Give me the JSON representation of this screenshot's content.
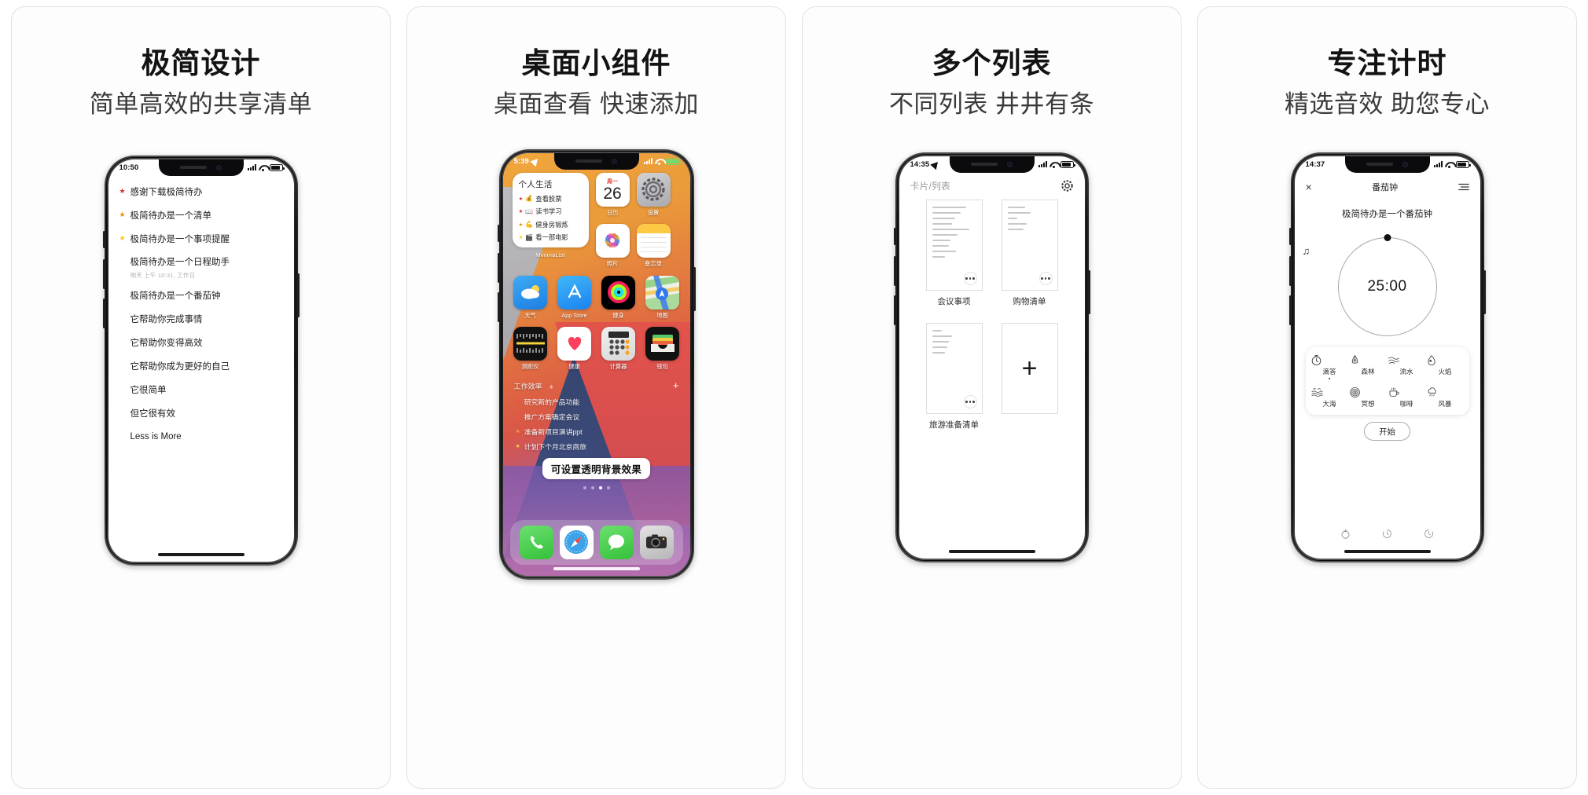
{
  "panels": [
    {
      "title": "极简设计",
      "subtitle": "简单高效的共享清单",
      "phone": {
        "status": {
          "time": "10:50"
        },
        "todos": [
          {
            "text": "感谢下载极简待办",
            "star": "#e03131",
            "meta": ""
          },
          {
            "text": "极简待办是一个清单",
            "star": "#f08c00",
            "meta": ""
          },
          {
            "text": "极简待办是一个事项提醒",
            "star": "#f5cb12",
            "meta": ""
          },
          {
            "text": "极简待办是一个日程助手",
            "star": "",
            "meta": "明天 上午 10:31, 工作日"
          },
          {
            "text": "极简待办是一个番茄钟",
            "star": "",
            "meta": ""
          },
          {
            "text": "它帮助你完成事情",
            "star": "",
            "meta": ""
          },
          {
            "text": "它帮助你变得高效",
            "star": "",
            "meta": ""
          },
          {
            "text": "它帮助你成为更好的自己",
            "star": "",
            "meta": ""
          },
          {
            "text": "它很简单",
            "star": "",
            "meta": ""
          },
          {
            "text": "但它很有效",
            "star": "",
            "meta": ""
          },
          {
            "text": "Less is More",
            "star": "",
            "meta": ""
          }
        ]
      }
    },
    {
      "title": "桌面小组件",
      "subtitle": "桌面查看 快速添加",
      "phone": {
        "status": {
          "time": "5:39"
        },
        "widget": {
          "title": "个人生活",
          "app_label": "MinimaList",
          "items": [
            {
              "emoji": "💰",
              "text": "查看股票",
              "star": "#e03131"
            },
            {
              "emoji": "📖",
              "text": "读书学习",
              "star": "#e03131"
            },
            {
              "emoji": "💪",
              "text": "健身房锻炼",
              "star": "#f08c00"
            },
            {
              "emoji": "🎬",
              "text": "看一部电影",
              "star": "#f5cb12"
            }
          ]
        },
        "calendar": {
          "weekday": "周一",
          "day": "26",
          "label": "日历"
        },
        "apps_row1": [
          {
            "label": "设置"
          }
        ],
        "apps": [
          {
            "label": "照片"
          },
          {
            "label": "备忘录"
          },
          {
            "label": "天气"
          },
          {
            "label": "App Store"
          },
          {
            "label": "健身"
          },
          {
            "label": "地图"
          },
          {
            "label": "测距仪"
          },
          {
            "label": "健康"
          },
          {
            "label": "计算器"
          },
          {
            "label": "钱包"
          }
        ],
        "section": {
          "label": "工作效率",
          "count": "4",
          "plus": "+"
        },
        "transparent_items": [
          {
            "text": "研究新的产品功能",
            "star": "#e8534a"
          },
          {
            "text": "推广方案确定会议",
            "star": "#e8534a"
          },
          {
            "text": "准备新项目演讲ppt",
            "star": "#f0a13c"
          },
          {
            "text": "计划下个月北京商旅",
            "star": "#f2d64a"
          }
        ],
        "tip": "可设置透明背景效果",
        "page_dots": 4,
        "active_dot": 3,
        "dock": [
          {
            "label": "电话"
          },
          {
            "label": "Safari"
          },
          {
            "label": "信息"
          },
          {
            "label": "相机"
          }
        ]
      }
    },
    {
      "title": "多个列表",
      "subtitle": "不同列表 井井有条",
      "phone": {
        "status": {
          "time": "14:35"
        },
        "header": {
          "active": "卡片",
          "sep": "/",
          "inactive": "列表",
          "gear": "gear-icon"
        },
        "cards": [
          {
            "name": "会议事项",
            "lines": 10
          },
          {
            "name": "购物清单",
            "lines": 5
          },
          {
            "name": "旅游准备清单",
            "lines": 5
          },
          {
            "name": "",
            "add": "+"
          }
        ]
      }
    },
    {
      "title": "专注计时",
      "subtitle": "精选音效 助您专心",
      "phone": {
        "status": {
          "time": "14:37"
        },
        "nav": {
          "close": "×",
          "title": "番茄钟",
          "menu": "list-icon"
        },
        "task": "极简待办是一个番茄钟",
        "timer": "25:00",
        "sounds": [
          {
            "glyph": "⏱",
            "label": "滴答",
            "selected": true
          },
          {
            "glyph": "🌲",
            "label": "森林",
            "selected": false
          },
          {
            "glyph": "≋",
            "label": "流水",
            "selected": false
          },
          {
            "glyph": "🔥",
            "label": "火焰",
            "selected": false
          },
          {
            "glyph": "🌊",
            "label": "大海",
            "selected": false
          },
          {
            "glyph": "◎",
            "label": "冥想",
            "selected": false
          },
          {
            "glyph": "☕",
            "label": "咖啡",
            "selected": false
          },
          {
            "glyph": "🌧",
            "label": "风暴",
            "selected": false
          }
        ],
        "start_label": "开始",
        "tabs": [
          {
            "icon": "tomato-icon"
          },
          {
            "icon": "clock-ccw-icon"
          },
          {
            "icon": "history-icon"
          }
        ]
      }
    }
  ]
}
